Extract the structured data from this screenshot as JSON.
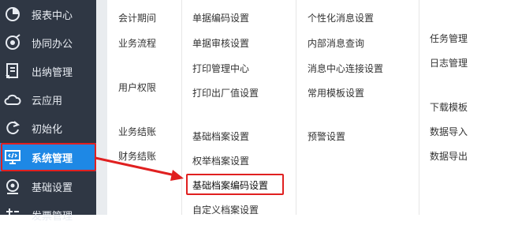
{
  "sidebar": {
    "items": [
      {
        "label": "报表中心",
        "icon": "report-icon"
      },
      {
        "label": "协同办公",
        "icon": "collaboration-icon"
      },
      {
        "label": "出纳管理",
        "icon": "cashier-icon"
      },
      {
        "label": "云应用",
        "icon": "cloud-icon"
      },
      {
        "label": "初始化",
        "icon": "init-icon"
      },
      {
        "label": "系统管理",
        "icon": "monitor-code-icon",
        "active": true
      },
      {
        "label": "基础设置",
        "icon": "settings-icon"
      },
      {
        "label": "发票管理",
        "icon": "invoice-icon"
      }
    ]
  },
  "menu": {
    "col1": [
      "会计期间",
      "业务流程",
      "用户权限",
      "业务结账",
      "财务结账"
    ],
    "col2": [
      "单据编码设置",
      "单据审核设置",
      "打印管理中心",
      "打印出厂值设置",
      "基础档案设置",
      "权举档案设置",
      "基础档案编码设置",
      "自定义档案设置"
    ],
    "col3": [
      "个性化消息设置",
      "内部消息查询",
      "消息中心连接设置",
      "常用模板设置",
      "预警设置"
    ],
    "col4": [
      "任务管理",
      "日志管理",
      "下载模板",
      "数据导入",
      "数据导出"
    ]
  },
  "colors": {
    "sidebar_bg": "#2f3744",
    "active_bg": "#1e88e5",
    "highlight_red": "#e02020"
  }
}
